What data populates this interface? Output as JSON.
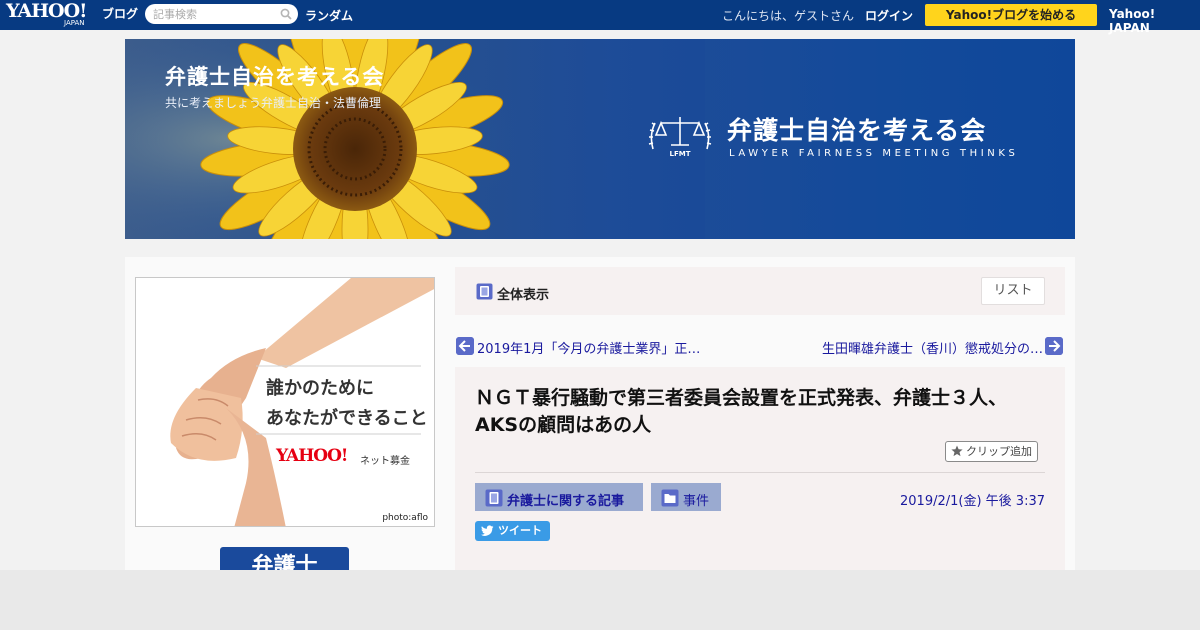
{
  "topbar": {
    "logo_text": "YAHOO!",
    "logo_sub": "JAPAN",
    "logo_blog": "ブログ",
    "search_placeholder": "記事検索",
    "random_label": "ランダム",
    "greeting": "こんにちは、ゲストさん",
    "login_label": "ログイン",
    "start_blog_label": "Yahoo!ブログを始める",
    "yahoo_japan_label": "Yahoo! JAPAN"
  },
  "banner": {
    "title": "弁護士自治を考える会",
    "subtitle": "共に考えましょう弁護士自治・法曹倫理",
    "logo_title": "弁護士自治を考える会",
    "logo_subtitle": "LAWYER FAIRNESS MEETING THINKS",
    "emblem_text": "LFMT"
  },
  "ad": {
    "line1": "誰かのために",
    "line2": "あなたができること",
    "brand": "YAHOO!",
    "brand_sub": "JAPAN",
    "service": "ネット募金",
    "credit": "photo:aflo"
  },
  "sidebar": {
    "badge_label": "弁護士"
  },
  "toolbar": {
    "view_label": "全体表示",
    "list_label": "リスト"
  },
  "pager": {
    "prev_label": "2019年1月「今月の弁護士業界」正…",
    "next_label": "生田暉雄弁護士（香川）懲戒処分の…"
  },
  "article": {
    "title": "ＮＧＴ暴行騒動で第三者委員会設置を正式発表、弁護士３人、AKSの顧問はあの人",
    "clip_label": "クリップ追加",
    "category_label": "弁護士に関する記事",
    "folder_label": "事件",
    "date": "2019/2/1(金) 午後 3:37",
    "tweet_label": "ツイート"
  },
  "colors": {
    "topbar_bg": "#073a82",
    "start_button": "#ffd41c",
    "link_blue": "#1a1a9e",
    "tag_bg": "#9aaad0",
    "tweet_bg": "#3a9be6"
  }
}
